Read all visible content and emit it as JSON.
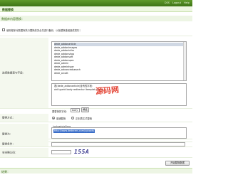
{
  "topbar": {
    "links": [
      "DSS",
      "Logout",
      "Help"
    ]
  },
  "title": "数据替换",
  "section_header": "数据库内容替换：",
  "backup_notice": "使用程序对数据库执行替换前务必先进行备份，以免替换错误造成损失！",
  "table_field": {
    "label": "选择数据表与字段：",
    "tables": [
      "dede_addonarticle",
      "dede_addonimages",
      "dede_addoninfos",
      "dede_addonshop",
      "dede_addonsoft",
      "dede_addonspec",
      "dede_admin",
      "dede_admintype",
      "dede_advancedsearch",
      "dede_arcatt"
    ]
  },
  "sql": {
    "line1": "表(dede_addonarticle)含有的字段：",
    "line2": "aid typeid body redirecturl templet userip"
  },
  "field_select": {
    "label": "要替换的字段：",
    "value": "body",
    "button": "确定"
  },
  "replace_mode": {
    "label": "替换方式：",
    "option_normal": "普通替换",
    "option_regex": "正则表达式替换"
  },
  "replace_find": {
    "label": "被替换内容：",
    "value": "/uploads/allimg"
  },
  "replace_with": {
    "label": "替换为：",
    "value": "http://www.dedecms.com/uploads"
  },
  "condition": {
    "label": "替换条件："
  },
  "captcha": {
    "label": "安全确认码：",
    "code": "155A"
  },
  "submit_button": "开始替换数据",
  "bottom_header": "结果：",
  "watermark": "源码网"
}
